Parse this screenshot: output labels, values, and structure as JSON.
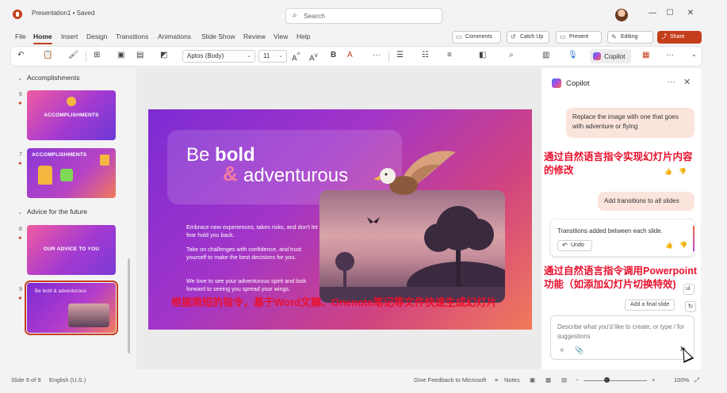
{
  "window": {
    "title": "Presentation1 • Saved",
    "search_placeholder": "Search",
    "minimize": "—",
    "maximize": "☐",
    "close": "✕"
  },
  "ribbon": {
    "tabs": [
      "File",
      "Home",
      "Insert",
      "Design",
      "Transitions",
      "Animations",
      "Slide Show",
      "Review",
      "View",
      "Help"
    ],
    "active_tab": "Home",
    "comments": "Comments",
    "catch_up": "Catch Up",
    "present": "Present",
    "editing": "Editing",
    "share": "Share"
  },
  "toolbar": {
    "font": "Aptos (Body)",
    "size": "11",
    "copilot": "Copilot",
    "more": "···"
  },
  "thumbnails": {
    "sections": [
      "Accomplishments",
      "Advice for the future"
    ],
    "slides": [
      {
        "num": "6",
        "label": "ACCOMPLISHMENTS"
      },
      {
        "num": "7",
        "label": "ACCOMPLISHMENTS"
      },
      {
        "num": "8",
        "label": "OUR ADVICE TO YOU"
      },
      {
        "num": "9",
        "label": "Be bold & adventurous"
      }
    ]
  },
  "slide": {
    "title_be": "Be ",
    "title_bold": "bold",
    "title_amp": "&",
    "title_rest": "adventurous",
    "para1": "Embrace new experiences, takes risks, and don't let fear hold you back.",
    "para2": "Take on challenges with confidence, and trust yourself to make the best decisions for you.",
    "para3": "We love to see your adventurous spirit and look forward to seeing you spread your wings."
  },
  "copilot": {
    "title": "Copilot",
    "user_msg1": "Replace the image with one that goes with adventure or flying",
    "user_msg2": "Add transitions to all slides",
    "bot_msg": "Transitions added between each slide.",
    "undo": "Undo",
    "suggestion_partial": "ul",
    "suggestion": "Add a final slide",
    "composer_placeholder": "Describe what you'd like to create, or type / for suggestions"
  },
  "annotations": {
    "note1": "通过自然语言指令实现幻灯片内容的修改",
    "note2": "通过自然语言指令调用Powerpoint功能（如添加幻灯片切换特效)",
    "note3": "根据简短的指令，基于Word文稿、Onenote笔记等文件快速生成幻灯片"
  },
  "status": {
    "slide_count": "Slide 9 of 9",
    "language": "English (U.S.)",
    "feedback": "Give Feedback to Microsoft",
    "notes": "Notes",
    "zoom": "100%"
  },
  "colors": {
    "accent": "#c43e1c",
    "annotation_red": "#e8112d",
    "slide_gradient_start": "#7c2bd3",
    "slide_gradient_end": "#f27a5a"
  }
}
